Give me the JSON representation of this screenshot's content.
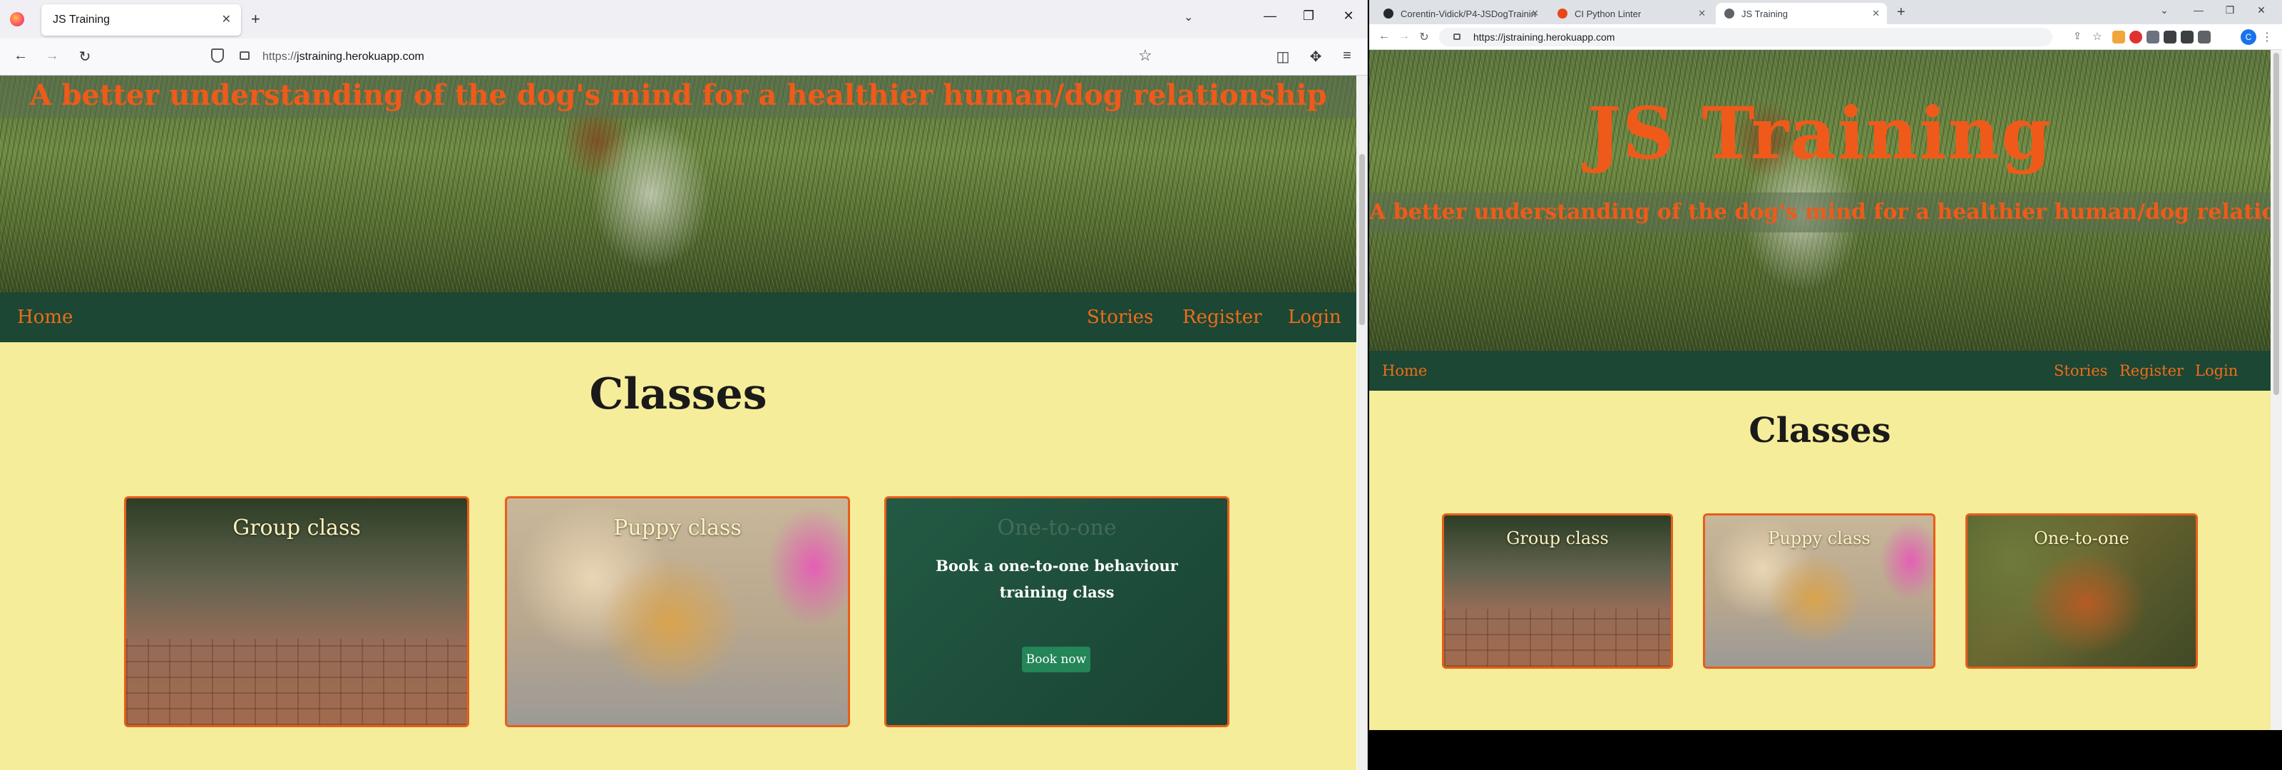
{
  "firefox": {
    "tab_title": "JS Training",
    "url_prefix": "https://",
    "url_host": "jstraining.herokuapp.com"
  },
  "chrome": {
    "tabs": [
      {
        "label": "Corentin-Vidick/P4-JSDogTrainin",
        "icon_color": "#24292f"
      },
      {
        "label": "CI Python Linter",
        "icon_color": "#e8461a"
      },
      {
        "label": "JS Training",
        "icon_color": "#5f6368"
      }
    ],
    "url": "https://jstraining.herokuapp.com",
    "avatar_letter": "C"
  },
  "site": {
    "brand": "JS Training",
    "tagline": "A better understanding of the dog's mind for a healthier human/dog relationship",
    "nav": {
      "home": "Home",
      "stories": "Stories",
      "register": "Register",
      "login": "Login"
    },
    "section_title": "Classes",
    "cards": [
      {
        "title": "Group class"
      },
      {
        "title": "Puppy class"
      },
      {
        "title": "One-to-one",
        "description": "Book a one-to-one behaviour training class",
        "button": "Book now"
      }
    ],
    "colors": {
      "accent": "#ef5a1a",
      "nav_bg": "#1b4734",
      "page_bg": "#f5ed9a",
      "card_border": "#e85d1a",
      "button_bg": "#238558"
    }
  }
}
